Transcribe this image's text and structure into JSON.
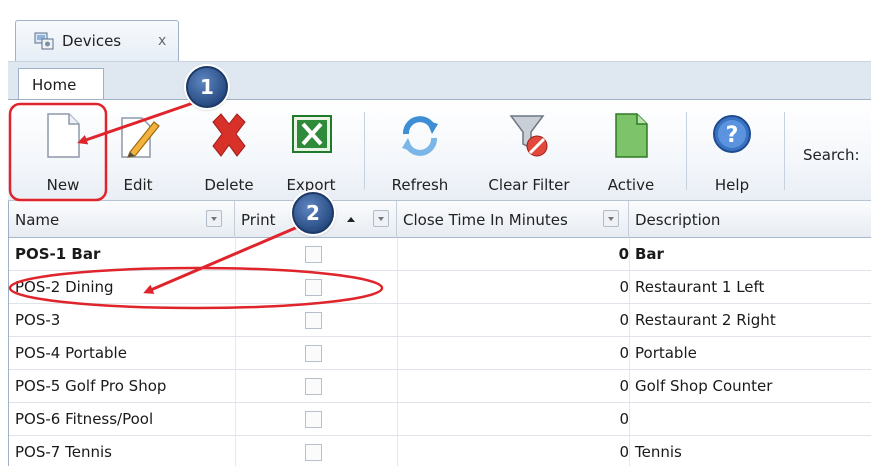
{
  "document_tab": {
    "label": "Devices",
    "close": "x"
  },
  "ribbon_tab": {
    "label": "Home"
  },
  "toolbar": {
    "new": "New",
    "edit": "Edit",
    "delete": "Delete",
    "export": "Export",
    "refresh": "Refresh",
    "clear_filter": "Clear Filter",
    "active": "Active",
    "help": "Help",
    "search_label": "Search:"
  },
  "grid": {
    "columns": {
      "name": "Name",
      "print": "Print",
      "close_time": "Close Time In Minutes",
      "description": "Description"
    },
    "rows": [
      {
        "name": "POS-1 Bar",
        "close_time": "0",
        "description": "Bar"
      },
      {
        "name": "POS-2 Dining",
        "close_time": "0",
        "description": "Restaurant 1 Left"
      },
      {
        "name": "POS-3",
        "close_time": "0",
        "description": "Restaurant 2 Right"
      },
      {
        "name": "POS-4 Portable",
        "close_time": "0",
        "description": "Portable"
      },
      {
        "name": "POS-5 Golf Pro Shop",
        "close_time": "0",
        "description": "Golf Shop Counter"
      },
      {
        "name": "POS-6 Fitness/Pool",
        "close_time": "0",
        "description": ""
      },
      {
        "name": "POS-7 Tennis",
        "close_time": "0",
        "description": "Tennis"
      }
    ]
  },
  "annotations": {
    "step1": "1",
    "step2": "2"
  },
  "colors": {
    "annotation_red": "#e0242c",
    "badge_blue": "#2f5597",
    "ribbon_border": "#9fb1c6",
    "delete_red": "#d8312a",
    "excel_green": "#1f7a2a"
  },
  "icons": {
    "document_tab": "devices-icon",
    "new": "new-document-icon",
    "edit": "edit-pencil-icon",
    "delete": "delete-x-icon",
    "export": "excel-icon",
    "refresh": "refresh-arrows-icon",
    "clear_filter": "clear-filter-funnel-icon",
    "active": "active-document-icon",
    "help": "help-question-icon"
  }
}
